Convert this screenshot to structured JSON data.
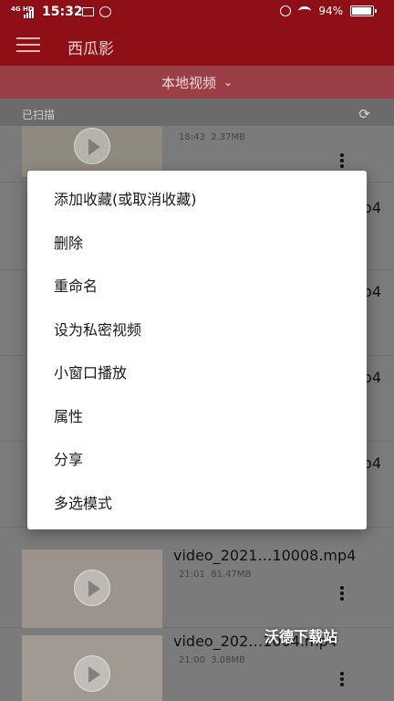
{
  "status_bar": {
    "network": "4G HD",
    "time": "15:32",
    "battery": "94%",
    "battery_level": 0.94
  },
  "toolbar": {
    "title": "西瓜影"
  },
  "subbar": {
    "label": "本地视频",
    "chevron": "⌄"
  },
  "list_header": {
    "label": "已扫描",
    "refresh_glyph": "⟳"
  },
  "videos": [
    {
      "name": "",
      "time": "18:43",
      "size": "2.37MB"
    },
    {
      "name": "video_2021…10008.mp4",
      "time": "21:01",
      "size": "81.47MB"
    },
    {
      "name": "video_202…1004.mp4",
      "time": "21:00",
      "size": "3.08MB"
    }
  ],
  "partial_suffix": "p4",
  "context_menu": {
    "items": [
      "添加收藏(或取消收藏)",
      "删除",
      "重命名",
      "设为私密视频",
      "小窗口播放",
      "属性",
      "分享",
      "多选模式"
    ]
  },
  "watermark": "沃德下载站",
  "colors": {
    "accent": "#8e1016",
    "dim_overlay": "#7b7b7b"
  }
}
